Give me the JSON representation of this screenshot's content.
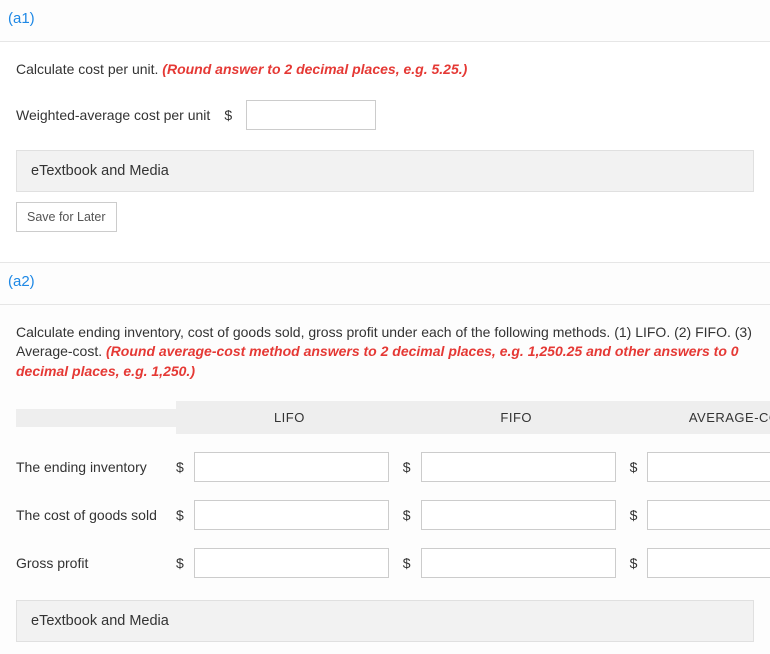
{
  "a1": {
    "header": "(a1)",
    "instruction": "Calculate cost per unit.",
    "hint": "(Round answer to 2 decimal places, e.g. 5.25.)",
    "field_label": "Weighted-average cost per unit",
    "currency": "$",
    "value": "",
    "etextbook_label": "eTextbook and Media",
    "save_label": "Save for Later"
  },
  "a2": {
    "header": "(a2)",
    "instruction": "Calculate ending inventory, cost of goods sold, gross profit under each of the following methods. (1) LIFO. (2) FIFO. (3) Average-cost.",
    "hint": "(Round average-cost method answers to 2 decimal places, e.g. 1,250.25 and other answers to 0 decimal places, e.g. 1,250.)",
    "columns": [
      "LIFO",
      "FIFO",
      "AVERAGE-COST"
    ],
    "rows": [
      {
        "label": "The ending inventory",
        "lifo": "",
        "fifo": "",
        "avg": ""
      },
      {
        "label": "The cost of goods sold",
        "lifo": "",
        "fifo": "",
        "avg": ""
      },
      {
        "label": "Gross profit",
        "lifo": "",
        "fifo": "",
        "avg": ""
      }
    ],
    "currency": "$",
    "etextbook_label": "eTextbook and Media"
  }
}
